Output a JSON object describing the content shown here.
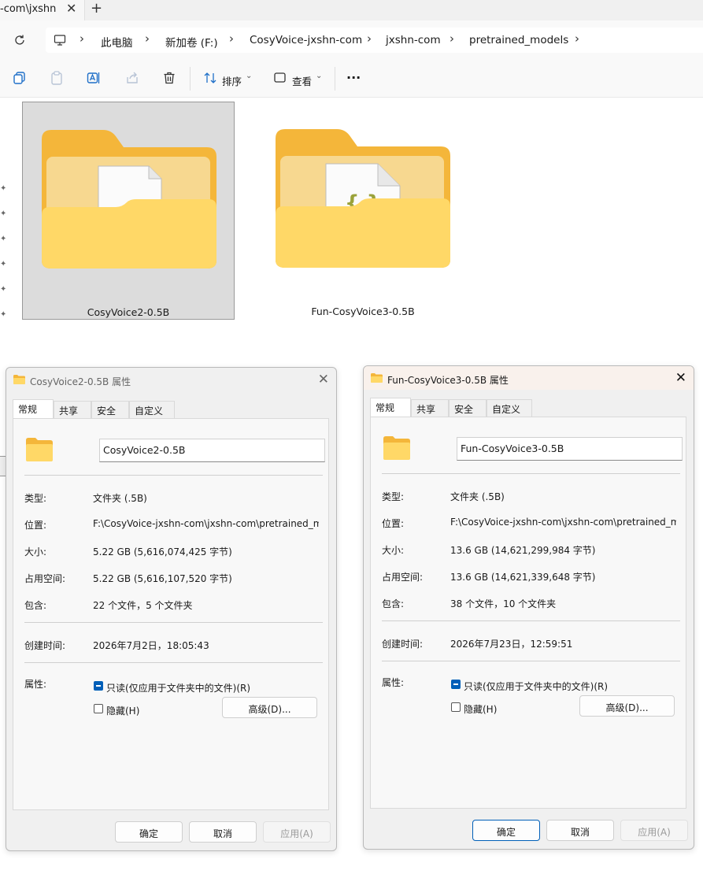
{
  "tab": {
    "title": "-com\\jxshn",
    "close": "✕",
    "new": "+"
  },
  "address": {
    "crumbs": [
      "此电脑",
      "新加卷 (F:)",
      "CosyVoice-jxshn-com",
      "jxshn-com",
      "pretrained_models"
    ],
    "separator": "›"
  },
  "toolbar": {
    "sort_label": "排序",
    "view_label": "查看",
    "more_label": "···"
  },
  "folders": [
    {
      "name": "CosyVoice2-0.5B",
      "selected": true
    },
    {
      "name": "Fun-CosyVoice3-0.5B",
      "selected": false
    }
  ],
  "dialogs": [
    {
      "title": "CosyVoice2-0.5B 属性",
      "close": "✕",
      "tabs": [
        "常规",
        "共享",
        "安全",
        "自定义"
      ],
      "name": "CosyVoice2-0.5B",
      "rows": [
        {
          "label": "类型:",
          "value": "文件夹 (.5B)"
        },
        {
          "label": "位置:",
          "value": "F:\\CosyVoice-jxshn-com\\jxshn-com\\pretrained_models"
        },
        {
          "label": "大小:",
          "value": "5.22 GB (5,616,074,425 字节)"
        },
        {
          "label": "占用空间:",
          "value": "5.22 GB (5,616,107,520 字节)"
        },
        {
          "label": "包含:",
          "value": "22 个文件，5 个文件夹"
        }
      ],
      "created": {
        "label": "创建时间:",
        "value": "2026年7月2日，18:05:43"
      },
      "attributes_label": "属性:",
      "readonly_label": "只读(仅应用于文件夹中的文件)(R)",
      "hidden_label": "隐藏(H)",
      "advanced_label": "高级(D)...",
      "ok": "确定",
      "cancel": "取消",
      "apply": "应用(A)"
    },
    {
      "title": "Fun-CosyVoice3-0.5B 属性",
      "close": "✕",
      "tabs": [
        "常规",
        "共享",
        "安全",
        "自定义"
      ],
      "name": "Fun-CosyVoice3-0.5B",
      "rows": [
        {
          "label": "类型:",
          "value": "文件夹 (.5B)"
        },
        {
          "label": "位置:",
          "value": "F:\\CosyVoice-jxshn-com\\jxshn-com\\pretrained_models"
        },
        {
          "label": "大小:",
          "value": "13.6 GB (14,621,299,984 字节)"
        },
        {
          "label": "占用空间:",
          "value": "13.6 GB (14,621,339,648 字节)"
        },
        {
          "label": "包含:",
          "value": "38 个文件，10 个文件夹"
        }
      ],
      "created": {
        "label": "创建时间:",
        "value": "2026年7月23日，12:59:51"
      },
      "attributes_label": "属性:",
      "readonly_label": "只读(仅应用于文件夹中的文件)(R)",
      "hidden_label": "隐藏(H)",
      "advanced_label": "高级(D)...",
      "ok": "确定",
      "cancel": "取消",
      "apply": "应用(A)"
    }
  ],
  "colors": {
    "accent": "#005fb8",
    "folder_back": "#f4b63a",
    "folder_front": "#ffd867"
  }
}
